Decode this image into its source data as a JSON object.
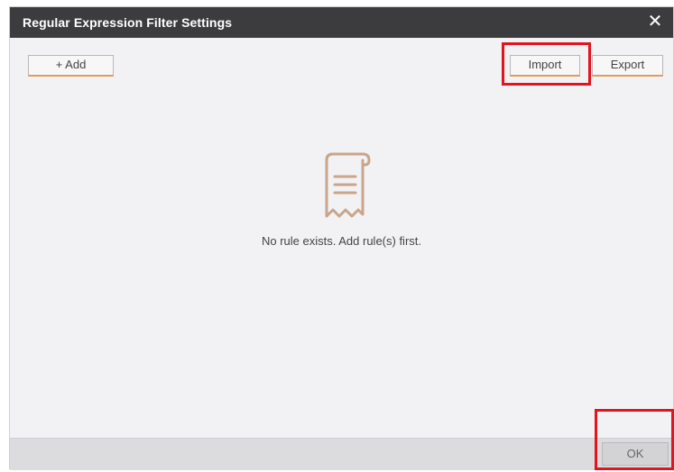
{
  "dialog": {
    "title": "Regular Expression Filter Settings",
    "close_symbol": "✕"
  },
  "toolbar": {
    "add_label": "+ Add",
    "import_label": "Import",
    "export_label": "Export"
  },
  "empty_state": {
    "icon": "receipt-icon",
    "message": "No rule exists. Add rule(s) first."
  },
  "footer": {
    "ok_label": "OK"
  },
  "colors": {
    "titlebar": "#3c3c3e",
    "accent_underline": "#e39a5c",
    "highlight_box": "#e3141e",
    "icon_color": "#c9a58b"
  }
}
